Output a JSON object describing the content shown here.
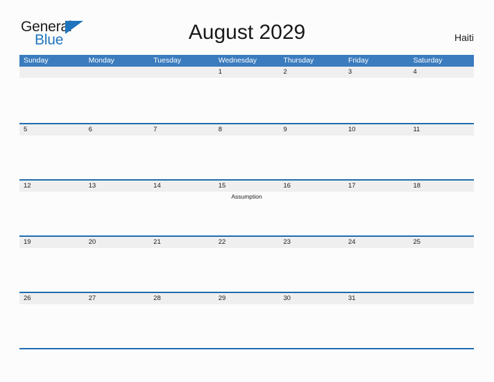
{
  "brand": {
    "name_part1": "General",
    "name_part2": "Blue",
    "triangle_color": "#1f74bd"
  },
  "header": {
    "title": "August 2029",
    "country": "Haiti"
  },
  "theme": {
    "header_blue": "#3a7cbe",
    "rule_blue": "#1f6cb0",
    "band_gray": "#efefef",
    "page_background": "#fcfcfc",
    "text_color": "#1a1a1a"
  },
  "calendar": {
    "weekdays": [
      "Sunday",
      "Monday",
      "Tuesday",
      "Wednesday",
      "Thursday",
      "Friday",
      "Saturday"
    ],
    "weeks": [
      {
        "days": [
          {
            "number": "",
            "events": []
          },
          {
            "number": "",
            "events": []
          },
          {
            "number": "",
            "events": []
          },
          {
            "number": "1",
            "events": []
          },
          {
            "number": "2",
            "events": []
          },
          {
            "number": "3",
            "events": []
          },
          {
            "number": "4",
            "events": []
          }
        ]
      },
      {
        "days": [
          {
            "number": "5",
            "events": []
          },
          {
            "number": "6",
            "events": []
          },
          {
            "number": "7",
            "events": []
          },
          {
            "number": "8",
            "events": []
          },
          {
            "number": "9",
            "events": []
          },
          {
            "number": "10",
            "events": []
          },
          {
            "number": "11",
            "events": []
          }
        ]
      },
      {
        "days": [
          {
            "number": "12",
            "events": []
          },
          {
            "number": "13",
            "events": []
          },
          {
            "number": "14",
            "events": []
          },
          {
            "number": "15",
            "events": [
              "Assumption"
            ]
          },
          {
            "number": "16",
            "events": []
          },
          {
            "number": "17",
            "events": []
          },
          {
            "number": "18",
            "events": []
          }
        ]
      },
      {
        "days": [
          {
            "number": "19",
            "events": []
          },
          {
            "number": "20",
            "events": []
          },
          {
            "number": "21",
            "events": []
          },
          {
            "number": "22",
            "events": []
          },
          {
            "number": "23",
            "events": []
          },
          {
            "number": "24",
            "events": []
          },
          {
            "number": "25",
            "events": []
          }
        ]
      },
      {
        "days": [
          {
            "number": "26",
            "events": []
          },
          {
            "number": "27",
            "events": []
          },
          {
            "number": "28",
            "events": []
          },
          {
            "number": "29",
            "events": []
          },
          {
            "number": "30",
            "events": []
          },
          {
            "number": "31",
            "events": []
          },
          {
            "number": "",
            "events": []
          }
        ]
      }
    ]
  }
}
